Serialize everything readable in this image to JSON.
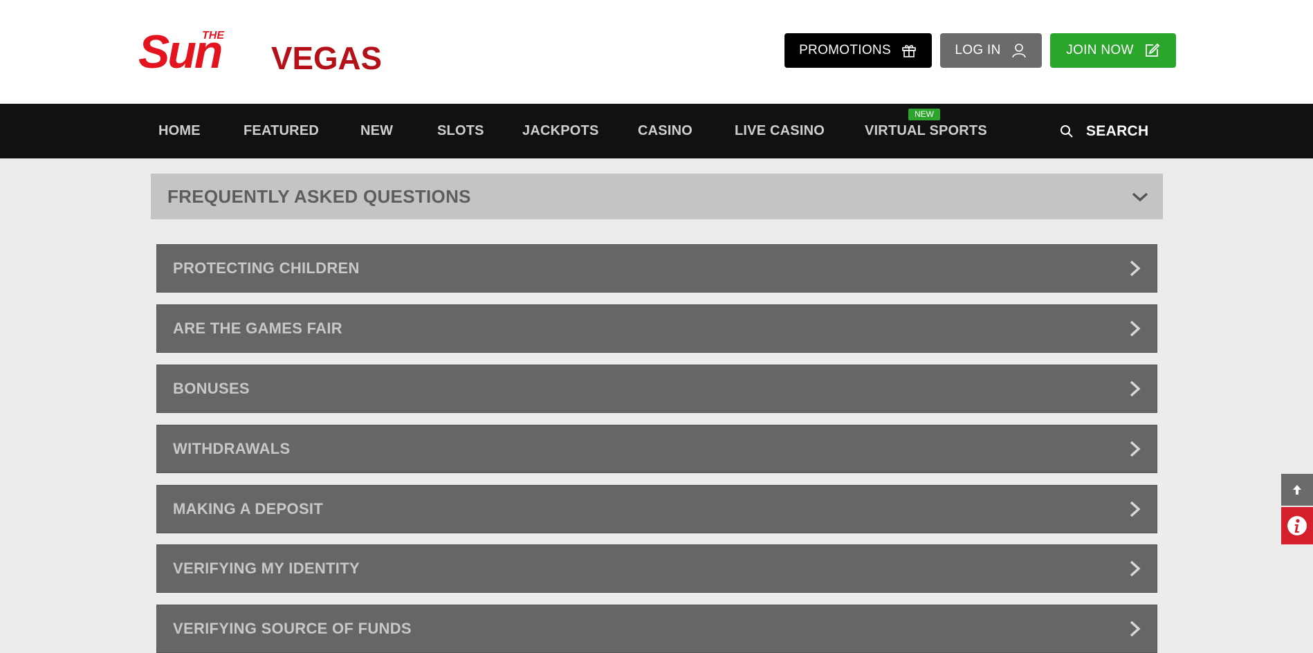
{
  "brand": {
    "logo_the": "THE",
    "logo_sun": "Sun",
    "logo_vegas": "VEGAS",
    "logo_red": "#e3141d",
    "logo_dark_red": "#b51018"
  },
  "header_buttons": {
    "promotions": "PROMOTIONS",
    "promotions_icon": "gift-icon",
    "login": "LOG IN",
    "login_icon": "user-icon",
    "join": "JOIN NOW",
    "join_icon": "edit-icon",
    "join_color": "#2ca52c"
  },
  "nav": {
    "items": [
      {
        "label": "HOME"
      },
      {
        "label": "FEATURED"
      },
      {
        "label": "NEW"
      },
      {
        "label": "SLOTS"
      },
      {
        "label": "JACKPOTS"
      },
      {
        "label": "CASINO"
      },
      {
        "label": "LIVE CASINO"
      },
      {
        "label": "VIRTUAL SPORTS",
        "badge": "NEW"
      }
    ],
    "search_label": "SEARCH",
    "search_icon": "search-icon"
  },
  "faq": {
    "title": "FREQUENTLY ASKED QUESTIONS",
    "items": [
      {
        "label": "PROTECTING CHILDREN"
      },
      {
        "label": "ARE THE GAMES FAIR"
      },
      {
        "label": "BONUSES"
      },
      {
        "label": "WITHDRAWALS"
      },
      {
        "label": "MAKING A DEPOSIT"
      },
      {
        "label": "VERIFYING MY IDENTITY"
      },
      {
        "label": "VERIFYING SOURCE OF FUNDS"
      }
    ]
  },
  "side_buttons": {
    "top_icon": "arrow-up-icon",
    "info_icon": "info-icon",
    "info_color": "#d3202b"
  }
}
